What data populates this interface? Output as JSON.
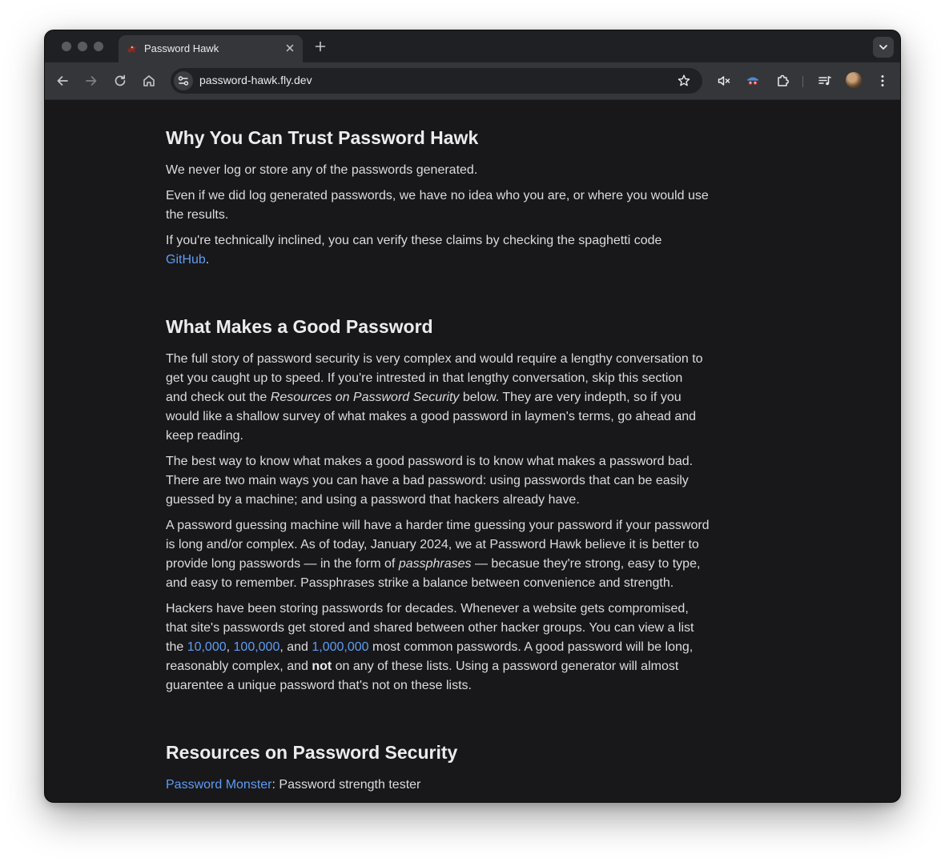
{
  "browser": {
    "tab_title": "Password Hawk",
    "url": "password-hawk.fly.dev"
  },
  "icons": {
    "back": "arrow-left-icon",
    "forward": "arrow-right-icon",
    "reload": "reload-icon",
    "home": "home-icon",
    "site_info": "tune-icon",
    "bookmark": "star-icon",
    "mute": "muted-speaker-icon",
    "spy": "incognito-icon",
    "extensions": "puzzle-icon",
    "media": "playlist-icon",
    "profile": "avatar-icon",
    "menu": "kebab-menu-icon"
  },
  "colors": {
    "page_bg": "#18181b",
    "link": "#5f9cf2",
    "text": "#dcdcdf"
  },
  "article": {
    "trust": {
      "heading": "Why You Can Trust Password Hawk",
      "p1": "We never log or store any of the passwords generated.",
      "p2_line1": "Even if we did log generated passwords, we have no idea who you are, or where you would use",
      "p2_line2": "the results.",
      "p3_line1": "If you're technically inclined, you can verify these claims by checking the spaghetti code",
      "p3_link": "GitHub",
      "p3_end": "."
    },
    "good": {
      "heading": "What Makes a Good Password",
      "p1_line1": "The full story of password security is very complex and would require a lengthy conversation to",
      "p1_line2": "get you caught up to speed. If you're intrested in that lengthy conversation, skip this section",
      "p1_line3_a": "and check out the ",
      "p1_line3_em": "Resources on Password Security",
      "p1_line3_b": " below. They are very indepth, so if you",
      "p1_line4": "would like a shallow survey of what makes a good password in laymen's terms, go ahead and",
      "p1_line5": "keep reading.",
      "p2_line1": "The best way to know what makes a good password is to know what makes a password bad.",
      "p2_line2": "There are two main ways you can have a bad password: using passwords that can be easily",
      "p2_line3": "guessed by a machine; and using a password that hackers already have.",
      "p3_line1": "A password guessing machine will have a harder time guessing your password if your password",
      "p3_line2": "is long and/or complex. As of today, January 2024, we at Password Hawk believe it is better to",
      "p3_line3_a": "provide long passwords — in the form of ",
      "p3_line3_em": "passphrases",
      "p3_line3_b": " — becasue they're strong, easy to type,",
      "p3_line4": "and easy to remember. Passphrases strike a balance between convenience and strength.",
      "p4_line1": "Hackers have been storing passwords for decades. Whenever a website gets compromised,",
      "p4_line2": "that site's passwords get stored and shared between other hacker groups. You can view a list",
      "p4_line3_a": "the ",
      "p4_link1": "10,000",
      "p4_sep1": ", ",
      "p4_link2": "100,000",
      "p4_sep2": ", and ",
      "p4_link3": "1,000,000",
      "p4_line3_b": " most common passwords. A good password will be long,",
      "p4_line4_a": "reasonably complex, and ",
      "p4_line4_strong": "not",
      "p4_line4_b": " on any of these lists. Using a password generator will almost",
      "p4_line5": "guarentee a unique password that's not on these lists."
    },
    "resources": {
      "heading": "Resources on Password Security",
      "item1_link": "Password Monster",
      "item1_text": ": Password strength tester"
    }
  }
}
